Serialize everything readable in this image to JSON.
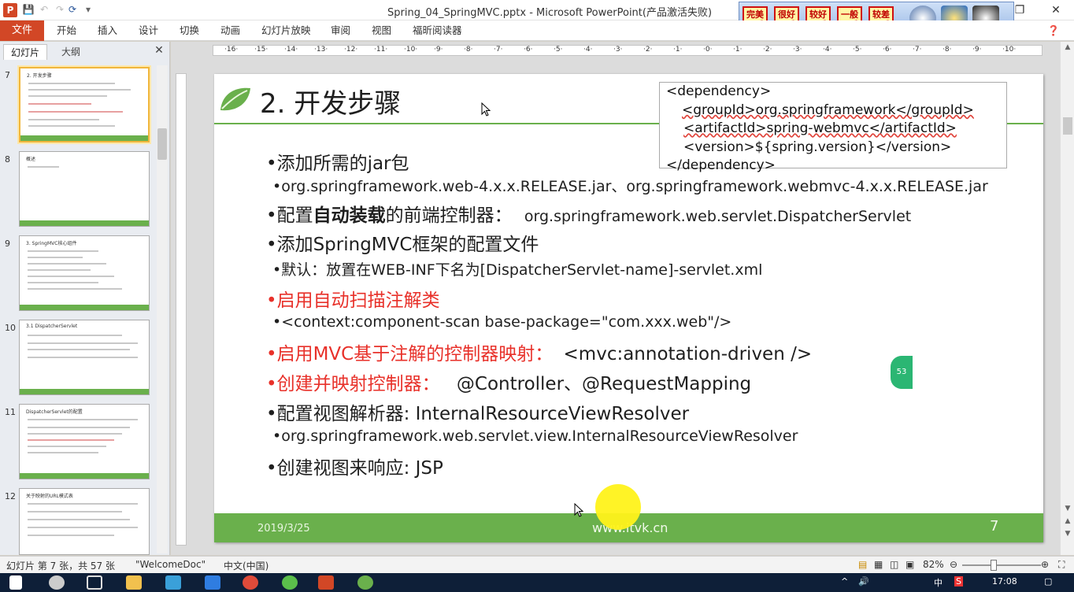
{
  "window": {
    "title": "Spring_04_SpringMVC.pptx - Microsoft PowerPoint(产品激活失败)",
    "app_icon": "P",
    "rating_buttons": [
      "完美画质",
      "很好画质",
      "较好画质",
      "一般画质",
      "较差画质"
    ]
  },
  "ribbon": {
    "file_tab": "文件",
    "tabs": [
      "开始",
      "插入",
      "设计",
      "切换",
      "动画",
      "幻灯片放映",
      "审阅",
      "视图",
      "福昕阅读器"
    ]
  },
  "left_panel": {
    "tab_slides": "幻灯片",
    "tab_outline": "大纲",
    "thumbnails": [
      {
        "num": "7",
        "title": "2. 开发步骤"
      },
      {
        "num": "8",
        "title": "概述"
      },
      {
        "num": "9",
        "title": "3. SpringMVC核心组件"
      },
      {
        "num": "10",
        "title": "3.1 DispatcherServlet"
      },
      {
        "num": "11",
        "title": "DispatcherServlet的配置"
      },
      {
        "num": "12",
        "title": "关于映射的URL模式表"
      }
    ]
  },
  "slide": {
    "title": "2. 开发步骤",
    "code": [
      "<dependency>",
      "<groupId>org.springframework</groupId>",
      "<artifactId>spring-webmvc</artifactId>",
      "<version>${spring.version}</version>",
      "</dependency>"
    ],
    "b1_add_jar": "•添加所需的jar包",
    "b2_jars": "•org.springframework.web-4.x.x.RELEASE.jar、org.springframework.webmvc-4.x.x.RELEASE.jar",
    "b3_prefix": "•配置",
    "b3_bold": "自动装载",
    "b3_mid": "的前端控制器：",
    "b3_class": "org.springframework.web.servlet.DispatcherServlet",
    "b4_config": "•添加SpringMVC框架的配置文件",
    "b5_default": "•默认：放置在WEB-INF下名为[DispatcherServlet-name]-servlet.xml",
    "b6_scan": "•启用自动扫描注解类",
    "b7_scan_tag": "•<context:component-scan base-package=\"com.xxx.web\"/>",
    "b8_mvc": "•启用MVC基于注解的控制器映射：",
    "b8_tag": "<mvc:annotation-driven />",
    "b9_controller": "•创建并映射控制器：",
    "b9_annotations": "@Controller、@RequestMapping",
    "b10_resolver": "•配置视图解析器: InternalResourceViewResolver",
    "b11_resolver_class": "•org.springframework.web.servlet.view.InternalResourceViewResolver",
    "b12_jsp": "•创建视图来响应: JSP",
    "footer_date": "2019/3/25",
    "footer_site": "www.itvk.cn",
    "footer_page": "7"
  },
  "status": {
    "slide_info": "幻灯片 第 7 张，共 57 张",
    "theme": "\"WelcomeDoc\"",
    "language": "中文(中国)",
    "zoom": "82%"
  },
  "taskbar": {
    "time": "17:08",
    "ime": "中"
  },
  "colors": {
    "accent_red": "#e8312a",
    "slide_green": "#6ab04c",
    "file_tab": "#d24726"
  }
}
